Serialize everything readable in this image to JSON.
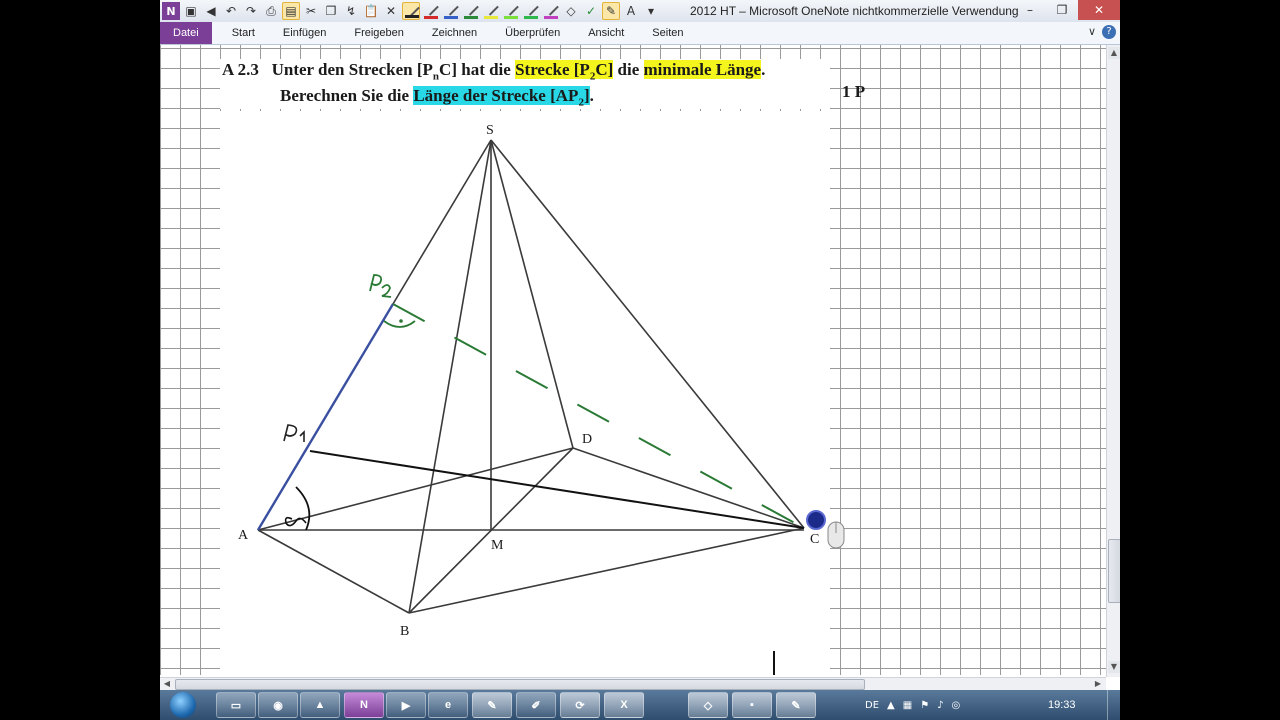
{
  "window": {
    "title": "2012 HT  –  Microsoft OneNote nichtkommerzielle Verwendung",
    "minimize": "–",
    "restore": "❐",
    "close": "✕"
  },
  "ribbon": {
    "tabs": [
      "Datei",
      "Start",
      "Einfügen",
      "Freigeben",
      "Zeichnen",
      "Überprüfen",
      "Ansicht",
      "Seiten"
    ],
    "collapse": "∨",
    "help": "?"
  },
  "pen_colors": [
    "#222222",
    "#d62a2a",
    "#3460c8",
    "#2a8a3a",
    "#e8e83a",
    "#7adf3a",
    "#2fb84a",
    "#c040c0"
  ],
  "task": {
    "number": "A 2.3",
    "line1_a": "Unter den Strecken [P",
    "line1_sub_n": "n",
    "line1_b": "C]  hat die ",
    "hl1_a": "Strecke [P",
    "hl1_sub": "2",
    "hl1_b": "C]",
    "line1_c": " die ",
    "hl2": "minimale Länge",
    "line1_d": ".",
    "line2_a": "Berechnen Sie die ",
    "hl3_a": "Länge der Strecke [AP",
    "hl3_sub": "2",
    "hl3_b": "]",
    "line2_b": ".",
    "points": "1 P"
  },
  "figure": {
    "labels": {
      "S": "S",
      "A": "A",
      "B": "B",
      "C": "C",
      "D": "D",
      "M": "M"
    },
    "line_color": "#3a3a3a",
    "ink_green": "#2a7a35",
    "edge_blue": "#3a4fa0"
  },
  "taskbar": {
    "apps": [
      "folder",
      "firefox",
      "vlc",
      "onenote",
      "media",
      "app6",
      "app7",
      "app8",
      "app9",
      "app10",
      "app11",
      "app12"
    ],
    "onenote_label": "N",
    "language": "DE",
    "time": "19:33"
  }
}
